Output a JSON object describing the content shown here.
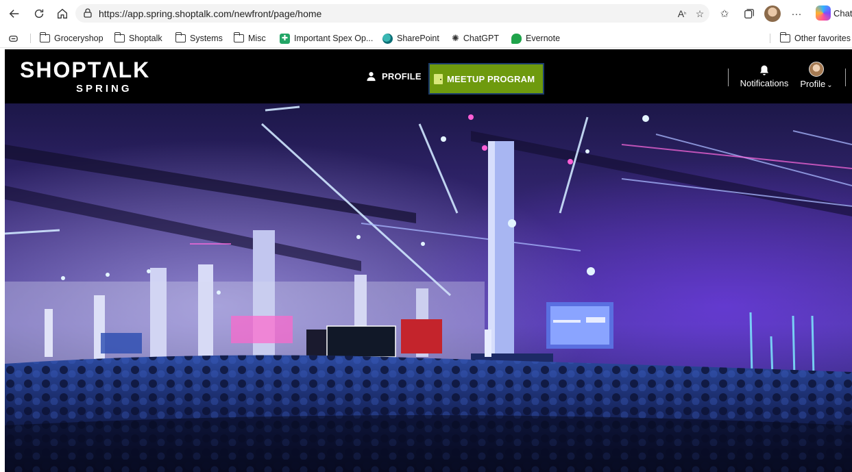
{
  "browser": {
    "url": "https://app.spring.shoptalk.com/newfront/page/home",
    "chat_label": "Chat",
    "icons": [
      "back-icon",
      "refresh-icon",
      "home-icon",
      "site-info-icon",
      "read-aloud-icon",
      "favorite-star-icon",
      "favorites-icon",
      "collections-icon",
      "profile-avatar-icon",
      "more-icon",
      "copilot-icon"
    ],
    "favorites": [
      {
        "label": "Groceryshop",
        "icon": "folder-icon"
      },
      {
        "label": "Shoptalk",
        "icon": "folder-icon"
      },
      {
        "label": "Systems",
        "icon": "folder-icon"
      },
      {
        "label": "Misc",
        "icon": "folder-icon"
      },
      {
        "label": "Important Spex Op...",
        "icon": "sheets-icon"
      },
      {
        "label": "SharePoint",
        "icon": "sharepoint-icon"
      },
      {
        "label": "ChatGPT",
        "icon": "chatgpt-icon"
      },
      {
        "label": "Evernote",
        "icon": "evernote-icon"
      }
    ],
    "other_favorites": "Other favorites"
  },
  "site": {
    "logo": "SHOPTΛLK",
    "logo_sub": "SPRING",
    "nav": {
      "profile": "PROFILE",
      "meetup": "MEETUP PROGRAM"
    },
    "notifications_label": "Notifications",
    "profile_label": "Profile",
    "profile_chevron": "⌄"
  },
  "colors": {
    "meetup_bg": "#6e9a0e",
    "meetup_border": "#1d3d6e",
    "header_bg": "#000000"
  }
}
